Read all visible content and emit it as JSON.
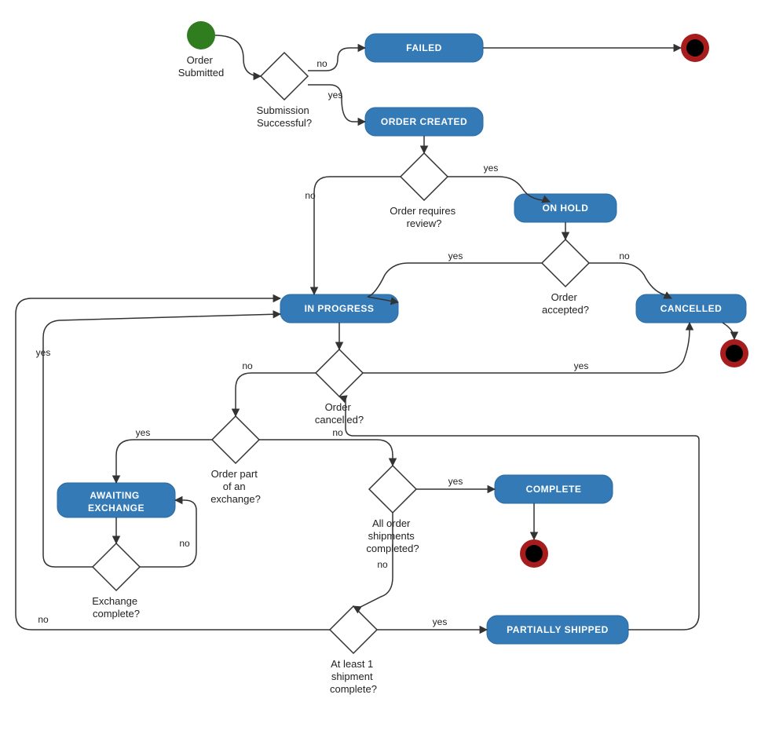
{
  "chart_data": {
    "type": "activity-state-flowchart",
    "start": "Order Submitted",
    "decisions": [
      {
        "id": "d1",
        "label": "Submission Successful?",
        "yes": "ORDER CREATED",
        "no": "FAILED"
      },
      {
        "id": "d2",
        "label": "Order requires review?",
        "yes": "ON HOLD",
        "no": "d3"
      },
      {
        "id": "d3",
        "label": "Order accepted?",
        "yes": "IN PROGRESS",
        "no": "CANCELLED"
      },
      {
        "id": "d4",
        "label": "Order cancelled?",
        "yes": "CANCELLED",
        "no": "d5"
      },
      {
        "id": "d5",
        "label": "Order part of an exchange?",
        "yes": "AWAITING EXCHANGE",
        "no": "d6"
      },
      {
        "id": "d6",
        "label": "All order shipments completed?",
        "yes": "COMPLETE",
        "no": "d7"
      },
      {
        "id": "d7",
        "label": "At least 1 shipment complete?",
        "yes": "PARTIALLY SHIPPED",
        "no": "IN PROGRESS"
      },
      {
        "id": "d8",
        "label": "Exchange complete?",
        "yes": "IN PROGRESS",
        "no": "AWAITING EXCHANGE"
      }
    ],
    "states": [
      "FAILED",
      "ORDER CREATED",
      "ON HOLD",
      "IN PROGRESS",
      "CANCELLED",
      "AWAITING EXCHANGE",
      "COMPLETE",
      "PARTIALLY SHIPPED"
    ],
    "terminals_after": [
      "FAILED",
      "CANCELLED",
      "COMPLETE"
    ],
    "loops": [
      "PARTIALLY SHIPPED -> d4",
      "AWAITING EXCHANGE -> d8",
      "IN PROGRESS -> d4"
    ]
  },
  "labels": {
    "order_submitted": "Order\nSubmitted",
    "submission_successful": "Submission\nSuccessful?",
    "failed": "FAILED",
    "order_created": "ORDER CREATED",
    "requires_review": "Order requires\nreview?",
    "on_hold": "ON HOLD",
    "order_accepted": "Order\naccepted?",
    "in_progress": "IN PROGRESS",
    "cancelled": "CANCELLED",
    "order_cancelled": "Order\ncancelled?",
    "order_part_exchange": "Order part\nof an\nexchange?",
    "awaiting_exchange": "AWAITING\nEXCHANGE",
    "all_shipments": "All order\nshipments\ncompleted?",
    "complete": "COMPLETE",
    "at_least_one": "At least 1\nshipment\ncomplete?",
    "partially_shipped": "PARTIALLY SHIPPED",
    "exchange_complete": "Exchange\ncomplete?",
    "yes": "yes",
    "no": "no"
  }
}
